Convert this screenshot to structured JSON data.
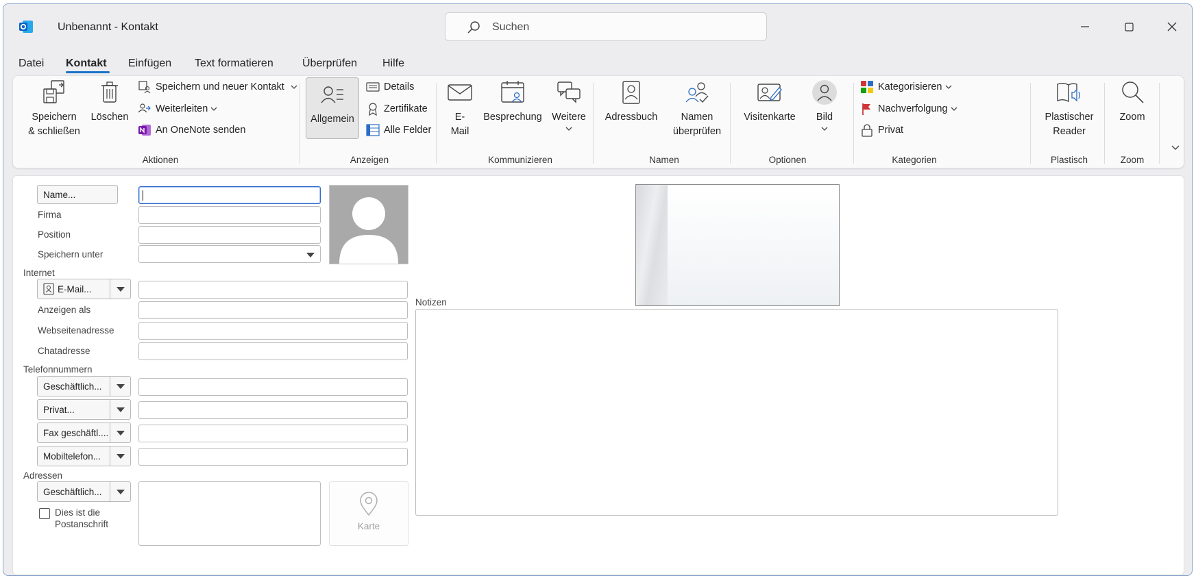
{
  "window": {
    "title": "Unbenannt  -  Kontakt",
    "search_placeholder": "Suchen"
  },
  "menu": {
    "tabs": [
      "Datei",
      "Kontakt",
      "Einfügen",
      "Text formatieren",
      "Überprüfen",
      "Hilfe"
    ],
    "active": "Kontakt"
  },
  "ribbon": {
    "aktionen": {
      "label": "Aktionen",
      "save_close_1": "Speichern",
      "save_close_2": "& schließen",
      "delete": "Löschen",
      "save_new": "Speichern und neuer Kontakt",
      "forward": "Weiterleiten",
      "onenote": "An OneNote senden"
    },
    "anzeigen": {
      "label": "Anzeigen",
      "general": "Allgemein",
      "details": "Details",
      "certificates": "Zertifikate",
      "all_fields": "Alle Felder"
    },
    "kommunizieren": {
      "label": "Kommunizieren",
      "email_1": "E-",
      "email_2": "Mail",
      "meeting": "Besprechung",
      "more": "Weitere"
    },
    "namen": {
      "label": "Namen",
      "address_book": "Adressbuch",
      "check_names_1": "Namen",
      "check_names_2": "überprüfen"
    },
    "optionen": {
      "label": "Optionen",
      "business_card": "Visitenkarte",
      "picture": "Bild"
    },
    "kategorien": {
      "label": "Kategorien",
      "categorize": "Kategorisieren",
      "follow_up": "Nachverfolgung",
      "private": "Privat"
    },
    "plastisch": {
      "label": "Plastisch",
      "reader_1": "Plastischer",
      "reader_2": "Reader"
    },
    "zoom": {
      "label": "Zoom",
      "zoom": "Zoom"
    }
  },
  "form": {
    "name_button": "Name...",
    "company": "Firma",
    "position": "Position",
    "file_as": "Speichern unter",
    "internet_section": "Internet",
    "email_button": "E-Mail...",
    "display_as": "Anzeigen als",
    "website": "Webseitenadresse",
    "chat": "Chatadresse",
    "phone_section": "Telefonnummern",
    "phone_business": "Geschäftlich...",
    "phone_private": "Privat...",
    "phone_fax": "Fax geschäftl....",
    "phone_mobile": "Mobiltelefon...",
    "address_section": "Adressen",
    "address_type": "Geschäftlich...",
    "postal_1": "Dies ist die",
    "postal_2": "Postanschrift",
    "map": "Karte",
    "notes": "Notizen"
  }
}
